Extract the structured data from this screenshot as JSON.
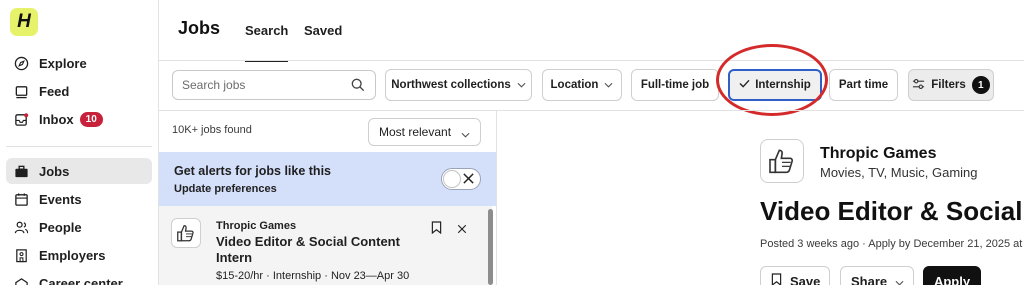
{
  "sidebar": {
    "logo": "H",
    "items": [
      {
        "label": "Explore"
      },
      {
        "label": "Feed"
      },
      {
        "label": "Inbox",
        "badge": "10"
      },
      {
        "label": "Jobs"
      },
      {
        "label": "Events"
      },
      {
        "label": "People"
      },
      {
        "label": "Employers"
      },
      {
        "label": "Career center"
      }
    ]
  },
  "header": {
    "title": "Jobs",
    "tabs": [
      {
        "label": "Search",
        "active": true
      },
      {
        "label": "Saved",
        "active": false
      }
    ]
  },
  "filters": {
    "search_placeholder": "Search jobs",
    "pills": [
      {
        "label": "Northwest collections"
      },
      {
        "label": "Location"
      },
      {
        "label": "Full-time job"
      },
      {
        "label": "Internship",
        "selected": true
      },
      {
        "label": "Part time"
      },
      {
        "label": "Filters",
        "count": "1"
      }
    ]
  },
  "results": {
    "count_text": "10K+ jobs found",
    "sort_label": "Most relevant",
    "alert": {
      "title": "Get alerts for jobs like this",
      "link": "Update preferences"
    },
    "jobs": [
      {
        "company": "Thropic Games",
        "title": "Video Editor & Social Content Intern",
        "meta": "$15-20/hr · Internship · Nov 23—Apr 30"
      }
    ]
  },
  "detail": {
    "company": "Thropic Games",
    "industry": "Movies, TV, Music, Gaming",
    "title": "Video Editor & Social C",
    "posted": "Posted 3 weeks ago · Apply by December 21, 2025 at",
    "buttons": {
      "save": "Save",
      "share": "Share",
      "apply": "Apply"
    }
  },
  "colors": {
    "brand_logo": "#e6f36a",
    "badge_red": "#c8213a",
    "alert_bg": "#d4dffa",
    "selected_border": "#2f5fc6",
    "annotation_red": "#d42a2a"
  }
}
